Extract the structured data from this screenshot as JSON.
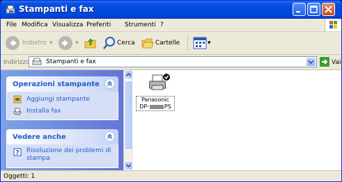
{
  "window": {
    "title": "Stampanti e fax"
  },
  "menu": [
    "File",
    "Modifica",
    "Visualizza",
    "Preferiti",
    "Strumenti",
    "?"
  ],
  "toolbar": {
    "back": "Indietro",
    "search": "Cerca",
    "folders": "Cartelle"
  },
  "address": {
    "label": "Indirizzo",
    "value": "Stampanti e fax",
    "go": "Vai"
  },
  "tasks_panel": {
    "title": "Operazioni stampante",
    "items": [
      "Aggiungi stampante",
      "Installa fax"
    ]
  },
  "see_also_panel": {
    "title": "Vedere anche",
    "items": [
      "Risoluzione dei problemi di",
      "stampa"
    ]
  },
  "printer": {
    "line1": "Panasonic",
    "line2_prefix": "DP-",
    "line2_suffix": "PS"
  },
  "status": {
    "text": "Oggetti: 1"
  },
  "colors": {
    "titlebar": "#0046d8",
    "link": "#215dc6",
    "panel_bg": "#d6dff7"
  }
}
